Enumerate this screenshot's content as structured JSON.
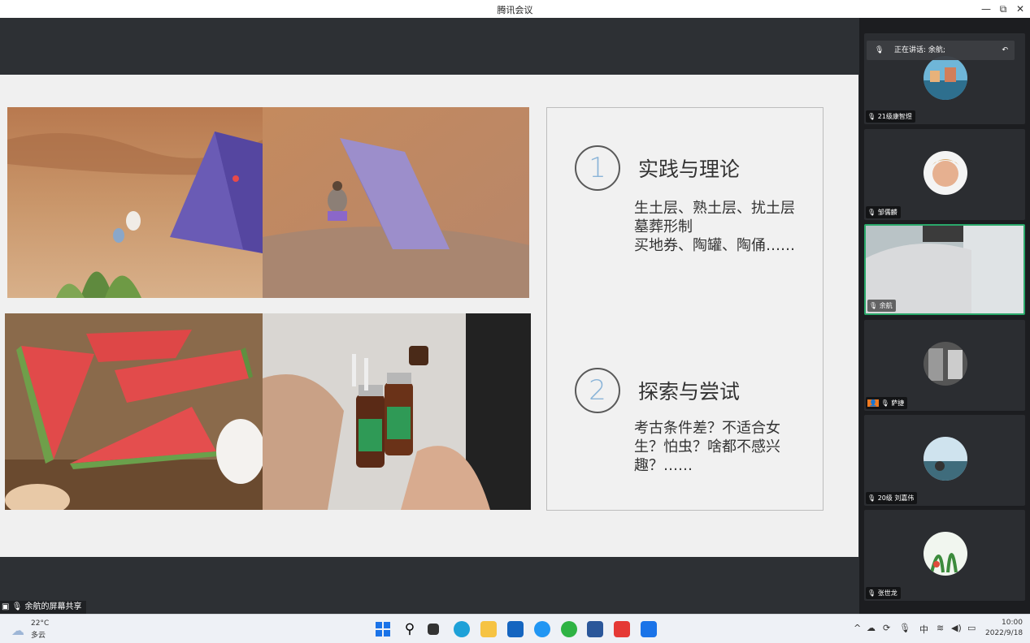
{
  "window": {
    "title": "腾讯会议"
  },
  "slide": {
    "item1": {
      "number": "1",
      "heading": "实践与理论",
      "lines": [
        "生土层、熟土层、扰土层",
        "墓葬形制",
        "买地券、陶罐、陶俑……"
      ]
    },
    "item2": {
      "number": "2",
      "heading": "探索与尝试",
      "lines": [
        "考古条件差？不适合女",
        "生？怕虫？啥都不感兴",
        "趣？……"
      ]
    }
  },
  "share_label": "余航的屏幕共享",
  "speaking_banner": "正在讲话: 余航;",
  "participants": [
    {
      "name": "21级康智煜"
    },
    {
      "name": "邹儒麟"
    },
    {
      "name": "余航"
    },
    {
      "name": "萨捷"
    },
    {
      "name": "20级 刘嘉伟"
    },
    {
      "name": "张世龙"
    }
  ],
  "taskbar": {
    "weather_temp": "22°C",
    "weather_desc": "多云",
    "ime": "中",
    "time": "10:00",
    "date": "2022/9/18"
  }
}
